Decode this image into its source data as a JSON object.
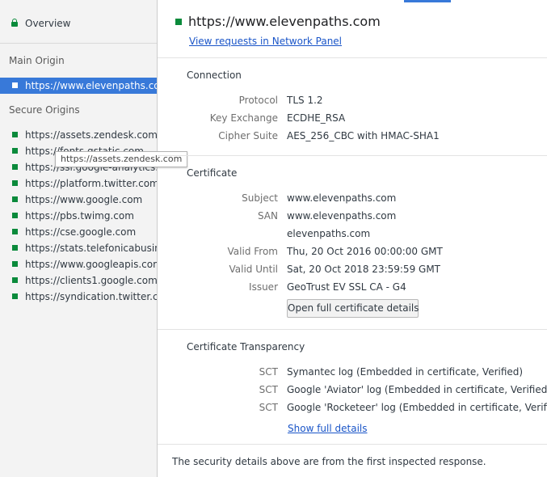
{
  "sidebar": {
    "overview_label": "Overview",
    "main_origin_heading": "Main Origin",
    "main_origin": "https://www.elevenpaths.com",
    "secure_origins_heading": "Secure Origins",
    "secure_origins": [
      "https://assets.zendesk.com",
      "https://fonts.gstatic.com",
      "https://ssl.google-analytics.com",
      "https://platform.twitter.com",
      "https://www.google.com",
      "https://pbs.twimg.com",
      "https://cse.google.com",
      "https://stats.telefonicabusiness",
      "https://www.googleapis.com",
      "https://clients1.google.com",
      "https://syndication.twitter.com"
    ],
    "tooltip": "https://assets.zendesk.com"
  },
  "header": {
    "origin": "https://www.elevenpaths.com",
    "network_link": "View requests in Network Panel"
  },
  "connection": {
    "title": "Connection",
    "rows": [
      {
        "label": "Protocol",
        "value": "TLS 1.2"
      },
      {
        "label": "Key Exchange",
        "value": "ECDHE_RSA"
      },
      {
        "label": "Cipher Suite",
        "value": "AES_256_CBC with HMAC-SHA1"
      }
    ]
  },
  "certificate": {
    "title": "Certificate",
    "subject_label": "Subject",
    "subject": "www.elevenpaths.com",
    "san_label": "SAN",
    "san": [
      "www.elevenpaths.com",
      "elevenpaths.com"
    ],
    "valid_from_label": "Valid From",
    "valid_from": "Thu, 20 Oct 2016 00:00:00 GMT",
    "valid_until_label": "Valid Until",
    "valid_until": "Sat, 20 Oct 2018 23:59:59 GMT",
    "issuer_label": "Issuer",
    "issuer": "GeoTrust EV SSL CA - G4",
    "open_button": "Open full certificate details"
  },
  "transparency": {
    "title": "Certificate Transparency",
    "rows": [
      {
        "label": "SCT",
        "value": "Symantec log (Embedded in certificate, Verified)"
      },
      {
        "label": "SCT",
        "value": "Google 'Aviator' log (Embedded in certificate, Verified)"
      },
      {
        "label": "SCT",
        "value": "Google 'Rocketeer' log (Embedded in certificate, Verified)"
      }
    ],
    "show_details": "Show full details"
  },
  "footer": "The security details above are from the first inspected response.",
  "colors": {
    "secure_green": "#0a8a3b",
    "selection_blue": "#3879d9",
    "link_blue": "#1a55c8"
  }
}
